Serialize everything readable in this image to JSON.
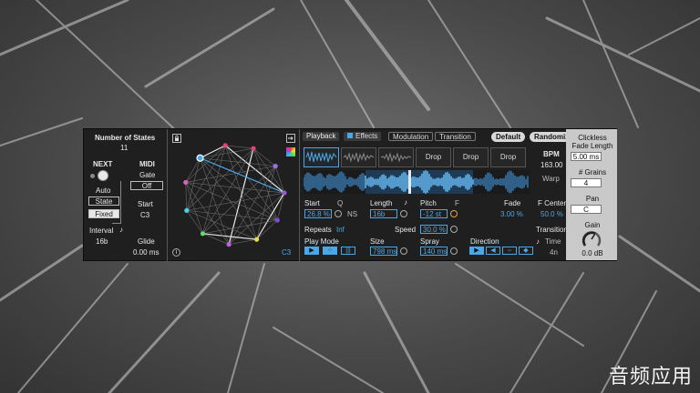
{
  "left_panel": {
    "states_title": "Number of States",
    "states_value": "11",
    "next_title": "NEXT",
    "midi_title": "MIDI",
    "gate_label": "Gate",
    "gate_value": "Off",
    "auto_label": "Auto",
    "state_label": "State",
    "fixed_label": "Fixed",
    "start_label": "Start",
    "start_value": "C3",
    "interval_label": "Interval",
    "interval_value": "16b",
    "glide_label": "Glide",
    "glide_value": "0.00 ms"
  },
  "graph_panel": {
    "note_label": "C3",
    "info_label": "i",
    "node_colors": [
      "#4aa8e8",
      "#e8407a",
      "#e8407a",
      "#a070e8",
      "#9b59d0",
      "#7a4fd8",
      "#e8e040",
      "#c060e0",
      "#60e060",
      "#4ad0e8",
      "#e060c0"
    ]
  },
  "tabs": {
    "playback": "Playback",
    "effects": "Effects",
    "modulation": "Modulation",
    "transition": "Transition",
    "default_btn": "Default",
    "randomize_btn": "Randomize"
  },
  "slots": [
    "Drop",
    "Drop",
    "Drop"
  ],
  "bpm": {
    "label": "BPM",
    "value": "163.00",
    "warp": "Warp"
  },
  "params": {
    "start_label": "Start",
    "start_value": "26.8 %",
    "q_label": "Q",
    "ns_label": "NS",
    "length_label": "Length",
    "length_value": "16b",
    "pitch_label": "Pitch",
    "pitch_value": "-12 st",
    "f_label": "F",
    "fade_label": "Fade",
    "fade_value": "3.00 %",
    "fcenter_label": "F Center",
    "fcenter_value": "50.0 %",
    "repeats_label": "Repeats",
    "repeats_value": "Inf",
    "speed_label": "Speed",
    "speed_value": "30.0 %",
    "transition_label": "Transition",
    "time_label": "Time",
    "time_value": "4n",
    "playmode_label": "Play Mode",
    "size_label": "Size",
    "size_value": "798 ms",
    "spray_label": "Spray",
    "spray_value": "140 ms",
    "direction_label": "Direction"
  },
  "right_panel": {
    "clickless_label": "Clickless",
    "fadelength_label": "Fade Length",
    "fadelength_value": "5.00 ms",
    "grains_label": "# Grains",
    "grains_value": "4",
    "pan_label": "Pan",
    "pan_value": "C",
    "gain_label": "Gain",
    "gain_value": "0.0 dB"
  },
  "watermark": "音频应用"
}
